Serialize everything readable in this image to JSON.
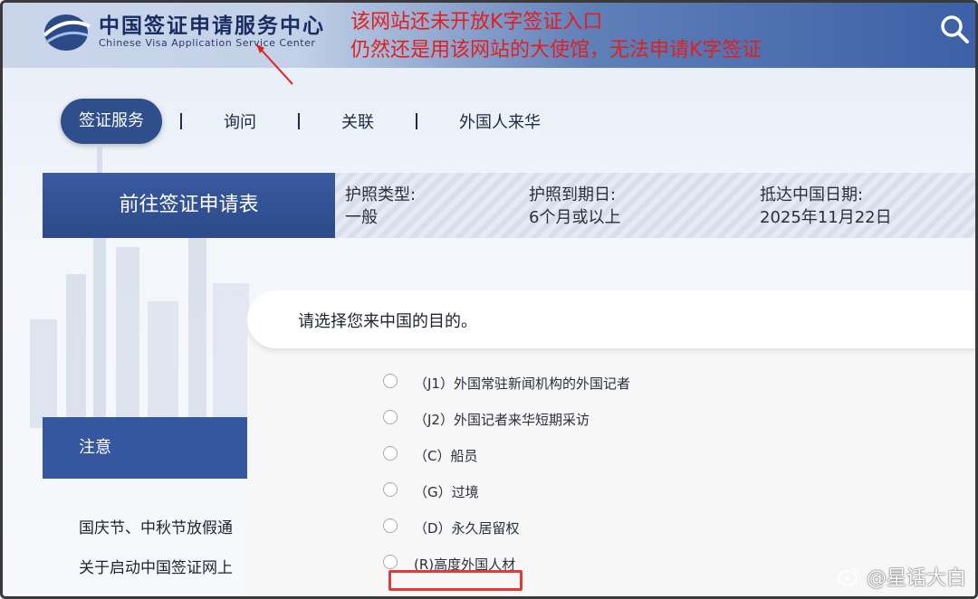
{
  "header": {
    "logo_cn": "中国签证申请服务中心",
    "logo_en": "Chinese Visa Application Service Center",
    "annotation_line1": "该网站还未开放K字签证入口",
    "annotation_line2": "仍然还是用该网站的大使馆，无法申请K字签证"
  },
  "nav": {
    "items": [
      "签证服务",
      "询问",
      "关联",
      "外国人来华"
    ]
  },
  "strip": {
    "title": "前往签证申请表",
    "fields": [
      {
        "label": "护照类型:",
        "value": "一般"
      },
      {
        "label": "护照到期日:",
        "value": "6个月或以上"
      },
      {
        "label": "抵达中国日期:",
        "value": "2025年11月22日"
      }
    ]
  },
  "notice": {
    "title": "注意",
    "links": [
      "国庆节、中秋节放假通",
      "关于启动中国签证网上"
    ]
  },
  "modal": {
    "title": "请选择您来中国的目的。",
    "options": [
      "（J1）外国常驻新闻机构的外国记者",
      "（J2）外国记者来华短期采访",
      "（C）船员",
      "（G）过境",
      "（D）永久居留权",
      "(R)高度外国人材"
    ]
  },
  "watermark": "@星话大白",
  "colors": {
    "accent": "#2e4f8c",
    "annotation": "#e02020",
    "highlight_box": "#e03a3a"
  }
}
